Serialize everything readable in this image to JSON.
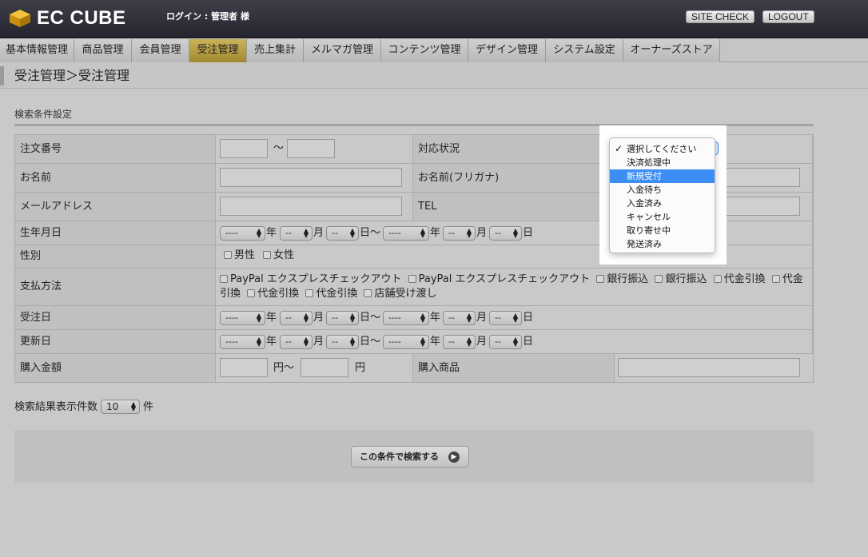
{
  "header": {
    "brand": "EC CUBE",
    "login_text": "ログイン : 管理者 様",
    "site_check": "SITE CHECK",
    "logout": "LOGOUT"
  },
  "menu": [
    {
      "label": "基本情報管理",
      "active": false
    },
    {
      "label": "商品管理",
      "active": false
    },
    {
      "label": "会員管理",
      "active": false
    },
    {
      "label": "受注管理",
      "active": true
    },
    {
      "label": "売上集計",
      "active": false
    },
    {
      "label": "メルマガ管理",
      "active": false
    },
    {
      "label": "コンテンツ管理",
      "active": false
    },
    {
      "label": "デザイン管理",
      "active": false
    },
    {
      "label": "システム設定",
      "active": false
    },
    {
      "label": "オーナーズストア",
      "active": false
    }
  ],
  "breadcrumb": "受注管理＞受注管理",
  "section_title": "検索条件設定",
  "form": {
    "order_no_label": "注文番号",
    "tilde": "〜",
    "status_label": "対応状況",
    "name_label": "お名前",
    "kana_label": "お名前(フリガナ)",
    "email_label": "メールアドレス",
    "tel_label": "TEL",
    "birth_label": "生年月日",
    "gender_label": "性別",
    "gender_male": "男性",
    "gender_female": "女性",
    "payment_label": "支払方法",
    "order_date_label": "受注日",
    "update_date_label": "更新日",
    "amount_label": "購入金額",
    "yen_tilde": "円〜",
    "yen": "円",
    "product_label": "購入商品",
    "year_placeholder": "----",
    "md_placeholder": "--",
    "year_unit": "年",
    "month_unit": "月",
    "day_unit": "日",
    "day_tilde": "日〜"
  },
  "payment_options": [
    "PayPal エクスプレスチェックアウト",
    "PayPal エクスプレスチェックアウト",
    "銀行振込",
    "銀行振込",
    "代金引換",
    "代金引換",
    "代金引換",
    "代金引換",
    "店舗受け渡し"
  ],
  "results": {
    "label": "検索結果表示件数",
    "value": "10",
    "unit": "件"
  },
  "search_button": "この条件で検索する",
  "status_dropdown": {
    "options": [
      "選択してください",
      "決済処理中",
      "新規受付",
      "入金待ち",
      "入金済み",
      "キャンセル",
      "取り寄せ中",
      "発送済み"
    ],
    "checked_index": 0,
    "highlighted_index": 2
  }
}
